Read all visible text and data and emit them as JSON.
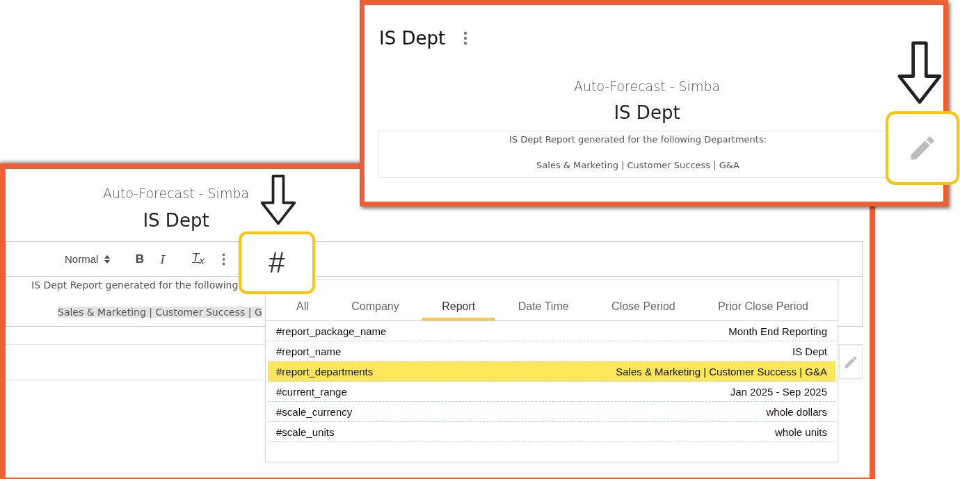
{
  "back_panel": {
    "subtitle": "Auto-Forecast - Simba",
    "title": "IS Dept",
    "toolbar": [
      {
        "kind": "select",
        "label": "Normal"
      },
      {
        "kind": "bold",
        "label": "B"
      },
      {
        "kind": "italic",
        "label": "I"
      },
      {
        "kind": "clear",
        "label": "T$_{x}$"
      },
      {
        "kind": "more"
      }
    ],
    "body_lines": [
      {
        "text": "IS Dept Report generated for the following",
        "highlighted": false
      },
      {
        "text": "Sales & Marketing | Customer Success | G",
        "highlighted": true
      }
    ],
    "tag_button": "#",
    "tag_menu": {
      "tabs": [
        {
          "label": "All",
          "selected": false
        },
        {
          "label": "Company",
          "selected": false
        },
        {
          "label": "Report",
          "selected": true
        },
        {
          "label": "Date Time",
          "selected": false
        },
        {
          "label": "Close Period",
          "selected": false
        },
        {
          "label": "Prior Close Period",
          "selected": false
        }
      ],
      "rows": [
        {
          "tag": "#report_package_name",
          "value": "Month End Reporting",
          "selected": false
        },
        {
          "tag": "#report_name",
          "value": "IS Dept",
          "selected": false
        },
        {
          "tag": "#report_departments",
          "value": "Sales & Marketing | Customer Success | G&A",
          "selected": true
        },
        {
          "tag": "#current_range",
          "value": "Jan 2025 - Sep 2025",
          "selected": false
        },
        {
          "tag": "#scale_currency",
          "value": "whole dollars",
          "selected": false
        },
        {
          "tag": "#scale_units",
          "value": "whole units",
          "selected": false
        }
      ]
    }
  },
  "front_panel": {
    "header": "IS Dept",
    "subtitle": "Auto-Forecast - Simba",
    "title": "IS Dept",
    "body_lines": [
      "IS Dept Report generated for the following Departments:",
      "Sales & Marketing | Customer Success | G&A"
    ]
  }
}
